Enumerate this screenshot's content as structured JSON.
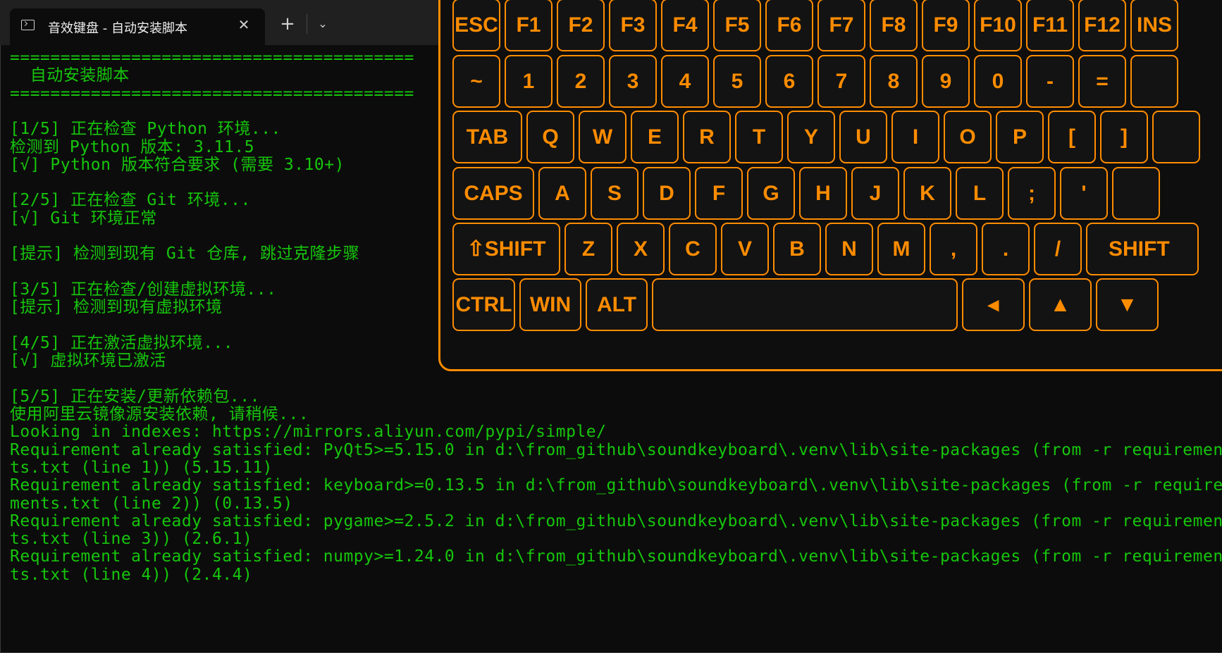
{
  "window": {
    "tab_title": "音效键盘 - 自动安装脚本",
    "tab_icon": "terminal-icon",
    "close_symbol": "✕",
    "new_tab_symbol": "+",
    "dropdown_symbol": "⌄"
  },
  "terminal": {
    "text_color": "#16c60c",
    "lines": [
      "========================================",
      "  自动安装脚本",
      "========================================",
      "",
      "[1/5] 正在检查 Python 环境...",
      "检测到 Python 版本: 3.11.5",
      "[√] Python 版本符合要求 (需要 3.10+)",
      "",
      "[2/5] 正在检查 Git 环境...",
      "[√] Git 环境正常",
      "",
      "[提示] 检测到现有 Git 仓库, 跳过克隆步骤",
      "",
      "[3/5] 正在检查/创建虚拟环境...",
      "[提示] 检测到现有虚拟环境",
      "",
      "[4/5] 正在激活虚拟环境...",
      "[√] 虚拟环境已激活",
      "",
      "[5/5] 正在安装/更新依赖包...",
      "使用阿里云镜像源安装依赖, 请稍候...",
      "Looking in indexes: https://mirrors.aliyun.com/pypi/simple/",
      "Requirement already satisfied: PyQt5>=5.15.0 in d:\\from_github\\soundkeyboard\\.venv\\lib\\site-packages (from -r requiremen",
      "ts.txt (line 1)) (5.15.11)",
      "Requirement already satisfied: keyboard>=0.13.5 in d:\\from_github\\soundkeyboard\\.venv\\lib\\site-packages (from -r require",
      "ments.txt (line 2)) (0.13.5)",
      "Requirement already satisfied: pygame>=2.5.2 in d:\\from_github\\soundkeyboard\\.venv\\lib\\site-packages (from -r requiremen",
      "ts.txt (line 3)) (2.6.1)",
      "Requirement already satisfied: numpy>=1.24.0 in d:\\from_github\\soundkeyboard\\.venv\\lib\\site-packages (from -r requiremen",
      "ts.txt (line 4)) (2.4.4)"
    ]
  },
  "keyboard": {
    "accent_color": "#ff8c00",
    "rows": [
      [
        "ESC",
        "F1",
        "F2",
        "F3",
        "F4",
        "F5",
        "F6",
        "F7",
        "F8",
        "F9",
        "F10",
        "F11",
        "F12",
        "INS"
      ],
      [
        "~",
        "1",
        "2",
        "3",
        "4",
        "5",
        "6",
        "7",
        "8",
        "9",
        "0",
        "-",
        "=",
        ""
      ],
      [
        "TAB",
        "Q",
        "W",
        "E",
        "R",
        "T",
        "Y",
        "U",
        "I",
        "O",
        "P",
        "[",
        "]",
        ""
      ],
      [
        "CAPS",
        "A",
        "S",
        "D",
        "F",
        "G",
        "H",
        "J",
        "K",
        "L",
        ";",
        "'",
        ""
      ],
      [
        "⇧SHIFT",
        "Z",
        "X",
        "C",
        "V",
        "B",
        "N",
        "M",
        ",",
        ".",
        "/",
        "SHIFT"
      ],
      [
        "CTRL",
        "WIN",
        "ALT",
        "",
        "◂",
        "▲",
        "▼"
      ]
    ]
  }
}
